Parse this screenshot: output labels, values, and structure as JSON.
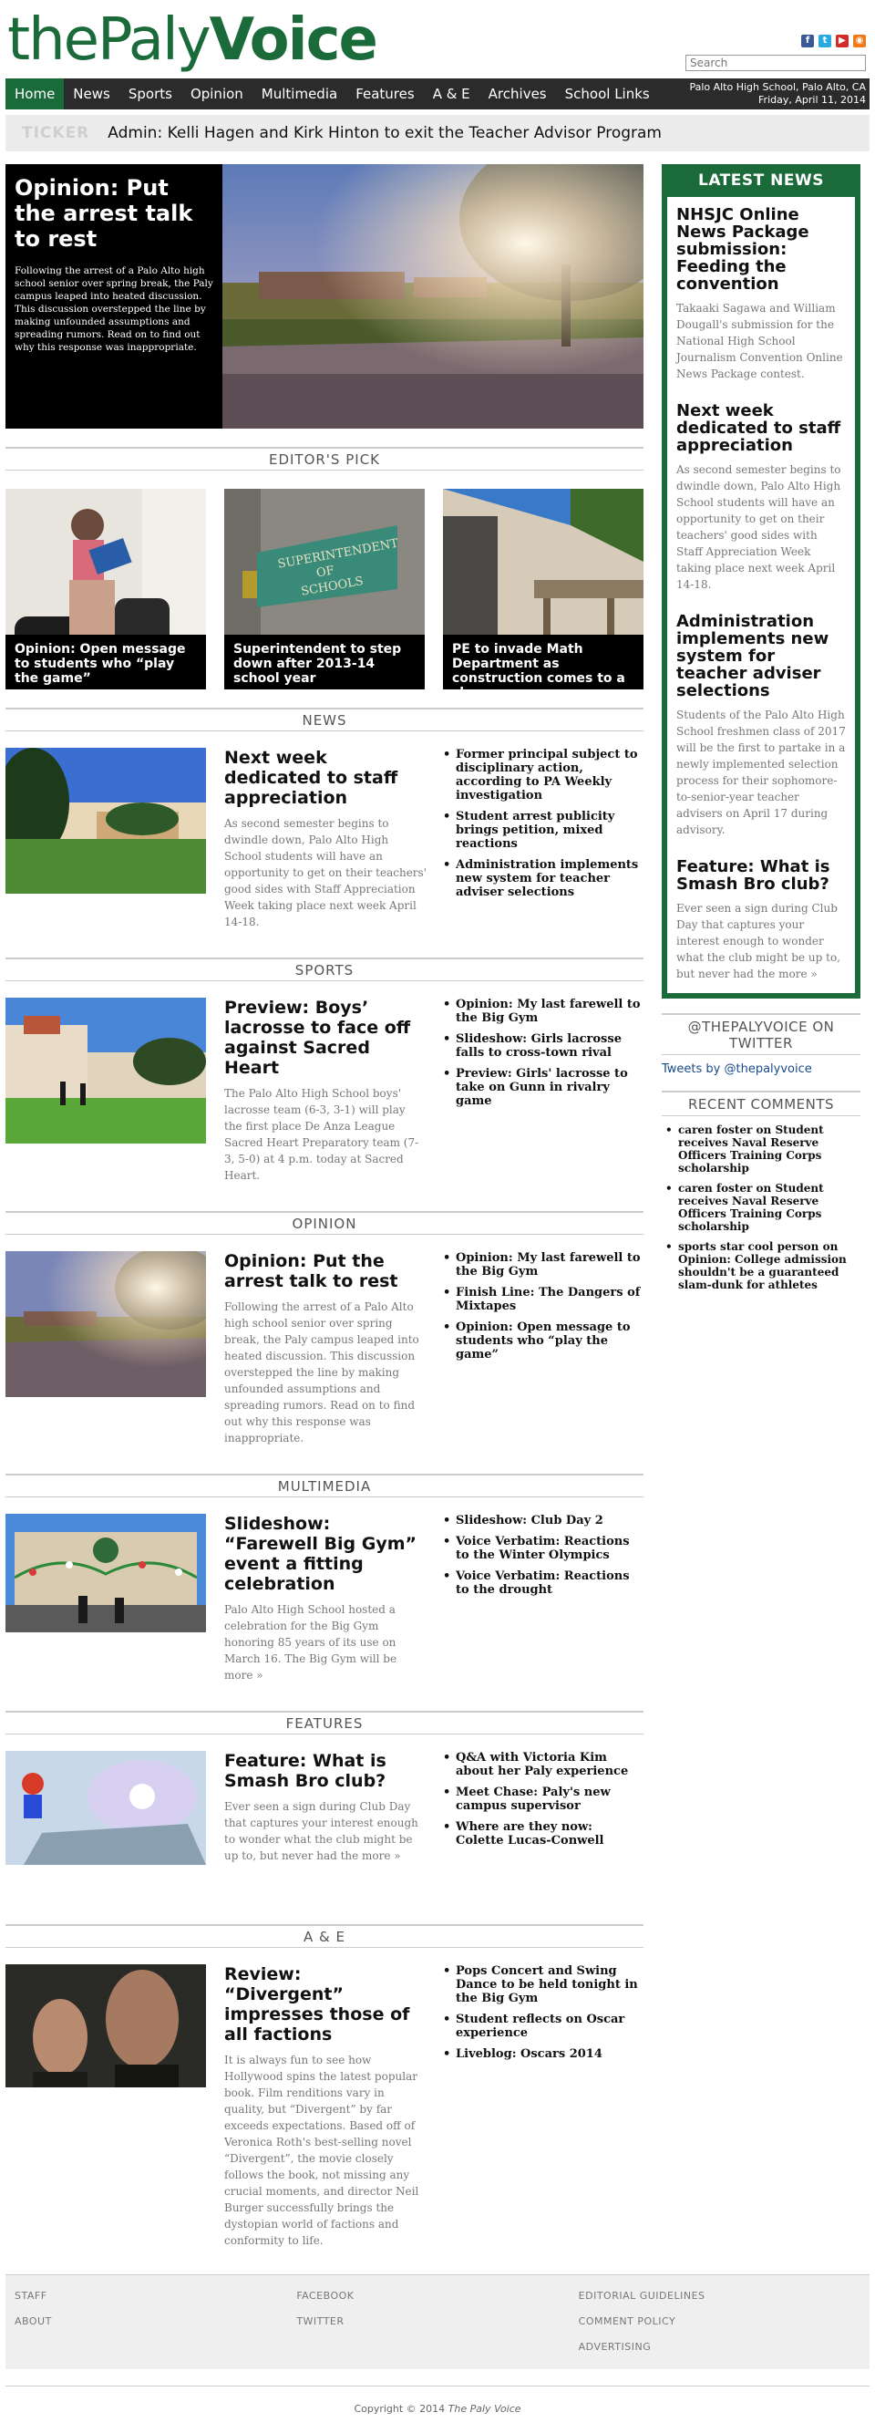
{
  "logo": {
    "part1": "the",
    "part2": "Paly",
    "part3": "Voice"
  },
  "header": {
    "search_placeholder": "Search",
    "location": "Palo Alto High School, Palo Alto, CA",
    "date": "Friday, April 11, 2014"
  },
  "nav": {
    "items": [
      "Home",
      "News",
      "Sports",
      "Opinion",
      "Multimedia",
      "Features",
      "A & E",
      "Archives",
      "School Links"
    ]
  },
  "ticker": {
    "label": "TICKER",
    "text": "Admin: Kelli Hagen and Kirk Hinton to exit the Teacher Advisor Program"
  },
  "hero": {
    "title": "Opinion: Put the arrest talk to rest",
    "body": "Following the arrest of a Palo Alto high school senior over spring break, the Paly campus leaped into heated discussion. This discussion overstepped the line by making unfounded assumptions and spreading rumors. Read on to find out why this response was inappropriate."
  },
  "editors_pick": {
    "heading": "EDITOR'S PICK",
    "items": [
      "Opinion: Open message to students who “play the game”",
      "Superintendent to step down after 2013-14 school year",
      "PE to invade Math Department as construction comes to a close"
    ],
    "sign_text": [
      "SUPERINTENDENT",
      "OF",
      "SCHOOLS"
    ]
  },
  "sections": [
    {
      "heading": "NEWS",
      "title": "Next week dedicated to staff appreciation",
      "body": "As second semester begins to dwindle down, Palo Alto High School students will have an opportunity to get on their teachers' good sides with Staff Appreciation Week taking place next week April 14-18.",
      "links": [
        "Former principal subject to disciplinary action, according to PA Weekly investigation",
        "Student arrest publicity brings petition, mixed reactions",
        "Administration implements new system for teacher adviser selections"
      ]
    },
    {
      "heading": "SPORTS",
      "title": "Preview: Boys’ lacrosse to face off against Sacred Heart",
      "body": "The Palo Alto High School boys' lacrosse team (6-3, 3-1) will play the first place De Anza League Sacred Heart Preparatory team (7-3, 5-0) at 4 p.m. today at Sacred Heart.",
      "links": [
        "Opinion: My last farewell to the Big Gym",
        "Slideshow: Girls lacrosse falls to cross-town rival",
        "Preview: Girls' lacrosse to take on Gunn in rivalry game"
      ]
    },
    {
      "heading": "OPINION",
      "title": "Opinion: Put the arrest talk to rest",
      "body": "Following the arrest of a Palo Alto high school senior over spring break, the Paly campus leaped into heated discussion. This discussion overstepped the line by making unfounded assumptions and spreading rumors. Read on to find out why this response was inappropriate.",
      "links": [
        "Opinion: My last farewell to the Big Gym",
        "Finish Line: The Dangers of Mixtapes",
        "Opinion: Open message to students who “play the game”"
      ]
    },
    {
      "heading": "MULTIMEDIA",
      "title": "Slideshow: “Farewell Big Gym” event a fitting celebration",
      "body": "Palo Alto High School hosted a celebration for the Big Gym honoring 85 years of its use on March 16. The Big Gym will be more »",
      "links": [
        "Slideshow: Club Day 2",
        "Voice Verbatim: Reactions to the Winter Olympics",
        "Voice Verbatim: Reactions to the drought"
      ]
    },
    {
      "heading": "FEATURES",
      "title": "Feature: What is Smash Bro club?",
      "body": "Ever seen a sign during Club Day that captures your interest enough to wonder what the club might be up to, but never had the more »",
      "links": [
        "Q&A with Victoria Kim about her Paly experience",
        "Meet Chase: Paly's new campus supervisor",
        "Where are they now: Colette Lucas-Conwell"
      ]
    },
    {
      "heading": "A & E",
      "title": "Review: “Divergent” impresses those of all factions",
      "body": "It is always fun to see how Hollywood spins the latest popular book. Film renditions vary in quality, but “Divergent” by far exceeds expectations. Based off of Veronica Roth's best-selling novel “Divergent”, the movie closely follows the book, not missing any crucial moments, and director Neil Burger successfully brings the dystopian world of factions and conformity to life.",
      "links": [
        "Pops Concert and Swing Dance to be held tonight in the Big Gym",
        "Student reflects on Oscar experience",
        "Liveblog: Oscars 2014"
      ]
    }
  ],
  "latest": {
    "heading": "LATEST NEWS",
    "items": [
      {
        "title": "NHSJC Online News Package submission: Feeding the convention",
        "body": "Takaaki Sagawa and William Dougall's submission for the National High School Journalism Convention Online News Package contest."
      },
      {
        "title": "Next week dedicated to staff appreciation",
        "body": "As second semester begins to dwindle down, Palo Alto High School students will have an opportunity to get on their teachers' good sides with Staff Appreciation Week taking place next week April 14-18."
      },
      {
        "title": "Administration implements new system for teacher adviser selections",
        "body": "Students of the Palo Alto High School freshmen class of 2017 will be the first to partake in a newly implemented selection process for their sophomore-to-senior-year teacher advisers on April 17 during advisory."
      },
      {
        "title": "Feature: What is Smash Bro club?",
        "body": "Ever seen a sign during Club Day that captures your interest enough to wonder what the club might be up to, but never had the more »"
      }
    ]
  },
  "twitter": {
    "heading": "@THEPALYVOICE ON TWITTER",
    "link": "Tweets by @thepalyvoice"
  },
  "comments": {
    "heading": "RECENT COMMENTS",
    "items": [
      "caren foster on Student receives Naval Reserve Officers Training Corps scholarship",
      "caren foster on Student receives Naval Reserve Officers Training Corps scholarship",
      "sports star cool person on Opinion: College admission shouldn't be a guaranteed slam-dunk for athletes"
    ]
  },
  "footer": {
    "col1": [
      "STAFF",
      "ABOUT"
    ],
    "col2": [
      "FACEBOOK",
      "TWITTER"
    ],
    "col3": [
      "EDITORIAL GUIDELINES",
      "COMMENT POLICY",
      "ADVERTISING"
    ],
    "copyright_prefix": "Copyright © 2014 ",
    "copyright_name": "The Paly Voice"
  },
  "colors": {
    "brand_green": "#1a6a3a",
    "nav_bg": "#2b2b2b"
  },
  "icons": [
    "facebook-icon",
    "twitter-icon",
    "youtube-icon",
    "rss-icon"
  ]
}
